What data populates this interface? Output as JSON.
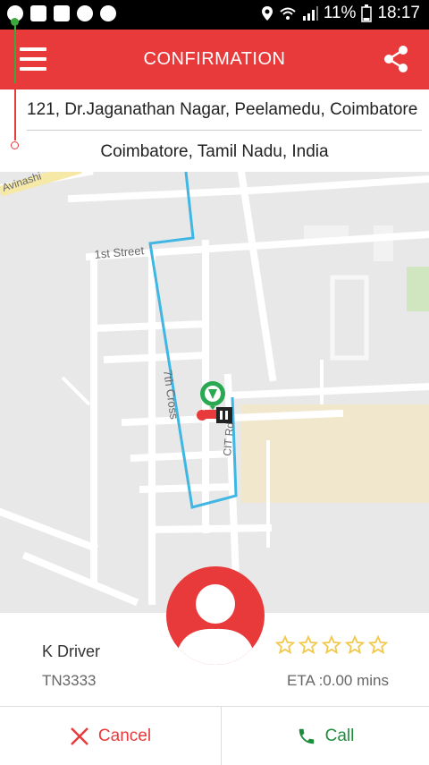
{
  "status_bar": {
    "battery": "11%",
    "time": "18:17"
  },
  "app_bar": {
    "title": "CONFIRMATION"
  },
  "route": {
    "pickup": "121, Dr.Jaganathan Nagar, Peelamedu, Coimbatore",
    "drop": "Coimbatore, Tamil Nadu, India"
  },
  "map": {
    "street_labels": [
      "Avinashi",
      "1st Street",
      "7th Cross",
      "CIT Rd"
    ],
    "colors": {
      "road": "#ffffff",
      "route": "#3fb6e3",
      "building": "#f5e7c2",
      "park": "#cfe6c0"
    }
  },
  "driver": {
    "name": "K Driver",
    "plate": "TN3333",
    "rating": 0,
    "eta": "ETA :0.00 mins"
  },
  "actions": {
    "cancel": "Cancel",
    "call": "Call"
  },
  "theme": {
    "accent": "#e83a3b",
    "call_green": "#1f8e3c",
    "pickup_green": "#3aa83a",
    "star": "#f2c94c"
  }
}
